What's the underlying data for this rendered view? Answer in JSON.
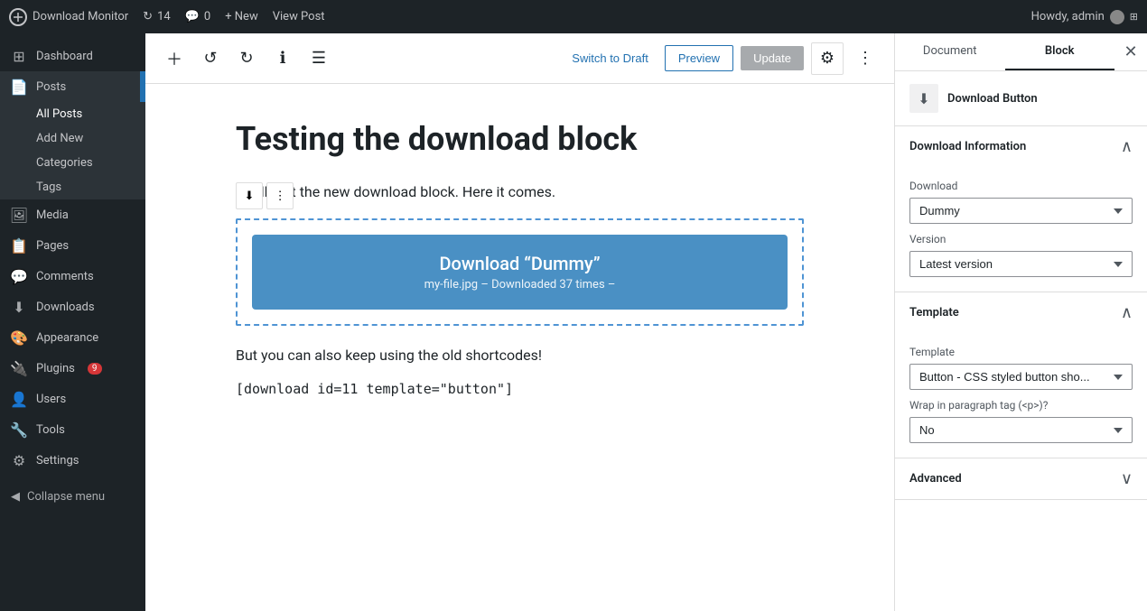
{
  "adminbar": {
    "logo_text": "Download Monitor",
    "revisions_count": "14",
    "comments_count": "0",
    "new_label": "+ New",
    "view_post_label": "View Post",
    "user_label": "Howdy, admin"
  },
  "sidebar": {
    "items": [
      {
        "id": "dashboard",
        "label": "Dashboard",
        "icon": "⊞"
      },
      {
        "id": "posts",
        "label": "Posts",
        "icon": "📄",
        "active": true,
        "has_arrow": true
      },
      {
        "id": "all-posts",
        "label": "All Posts",
        "sub": true,
        "current": true
      },
      {
        "id": "add-new",
        "label": "Add New",
        "sub": true
      },
      {
        "id": "categories",
        "label": "Categories",
        "sub": true
      },
      {
        "id": "tags",
        "label": "Tags",
        "sub": true
      },
      {
        "id": "media",
        "label": "Media",
        "icon": "🖼"
      },
      {
        "id": "pages",
        "label": "Pages",
        "icon": "📋"
      },
      {
        "id": "comments",
        "label": "Comments",
        "icon": "💬"
      },
      {
        "id": "downloads",
        "label": "Downloads",
        "icon": "⬇"
      },
      {
        "id": "appearance",
        "label": "Appearance",
        "icon": "🎨"
      },
      {
        "id": "plugins",
        "label": "Plugins",
        "icon": "🔌",
        "badge": "9"
      },
      {
        "id": "users",
        "label": "Users",
        "icon": "👤"
      },
      {
        "id": "tools",
        "label": "Tools",
        "icon": "🔧"
      },
      {
        "id": "settings",
        "label": "Settings",
        "icon": "⚙"
      }
    ],
    "collapse_label": "Collapse menu"
  },
  "toolbar": {
    "switch_draft_label": "Switch to Draft",
    "preview_label": "Preview",
    "update_label": "Update"
  },
  "editor": {
    "post_title": "Testing the download block",
    "post_text": "st, I'll test the new download block. Here it comes.",
    "download_button_title": "Download “Dummy”",
    "download_button_meta": "my-file.jpg – Downloaded 37 times –",
    "shortcode_text": "But you can also keep using the old shortcodes!",
    "shortcode": "[download id=11 template=\"button\"]"
  },
  "panel": {
    "tab_document": "Document",
    "tab_block": "Block",
    "block_name": "Download Button",
    "sections": {
      "download_info": {
        "title": "Download Information",
        "download_label": "Download",
        "download_value": "Dummy",
        "version_label": "Version",
        "version_value": "Latest version"
      },
      "template": {
        "title": "Template",
        "template_label": "Template",
        "template_value": "Button - CSS styled button sho...",
        "wrap_label": "Wrap in paragraph tag (<p>)?",
        "wrap_value": "No"
      },
      "advanced": {
        "title": "Advanced"
      }
    }
  }
}
